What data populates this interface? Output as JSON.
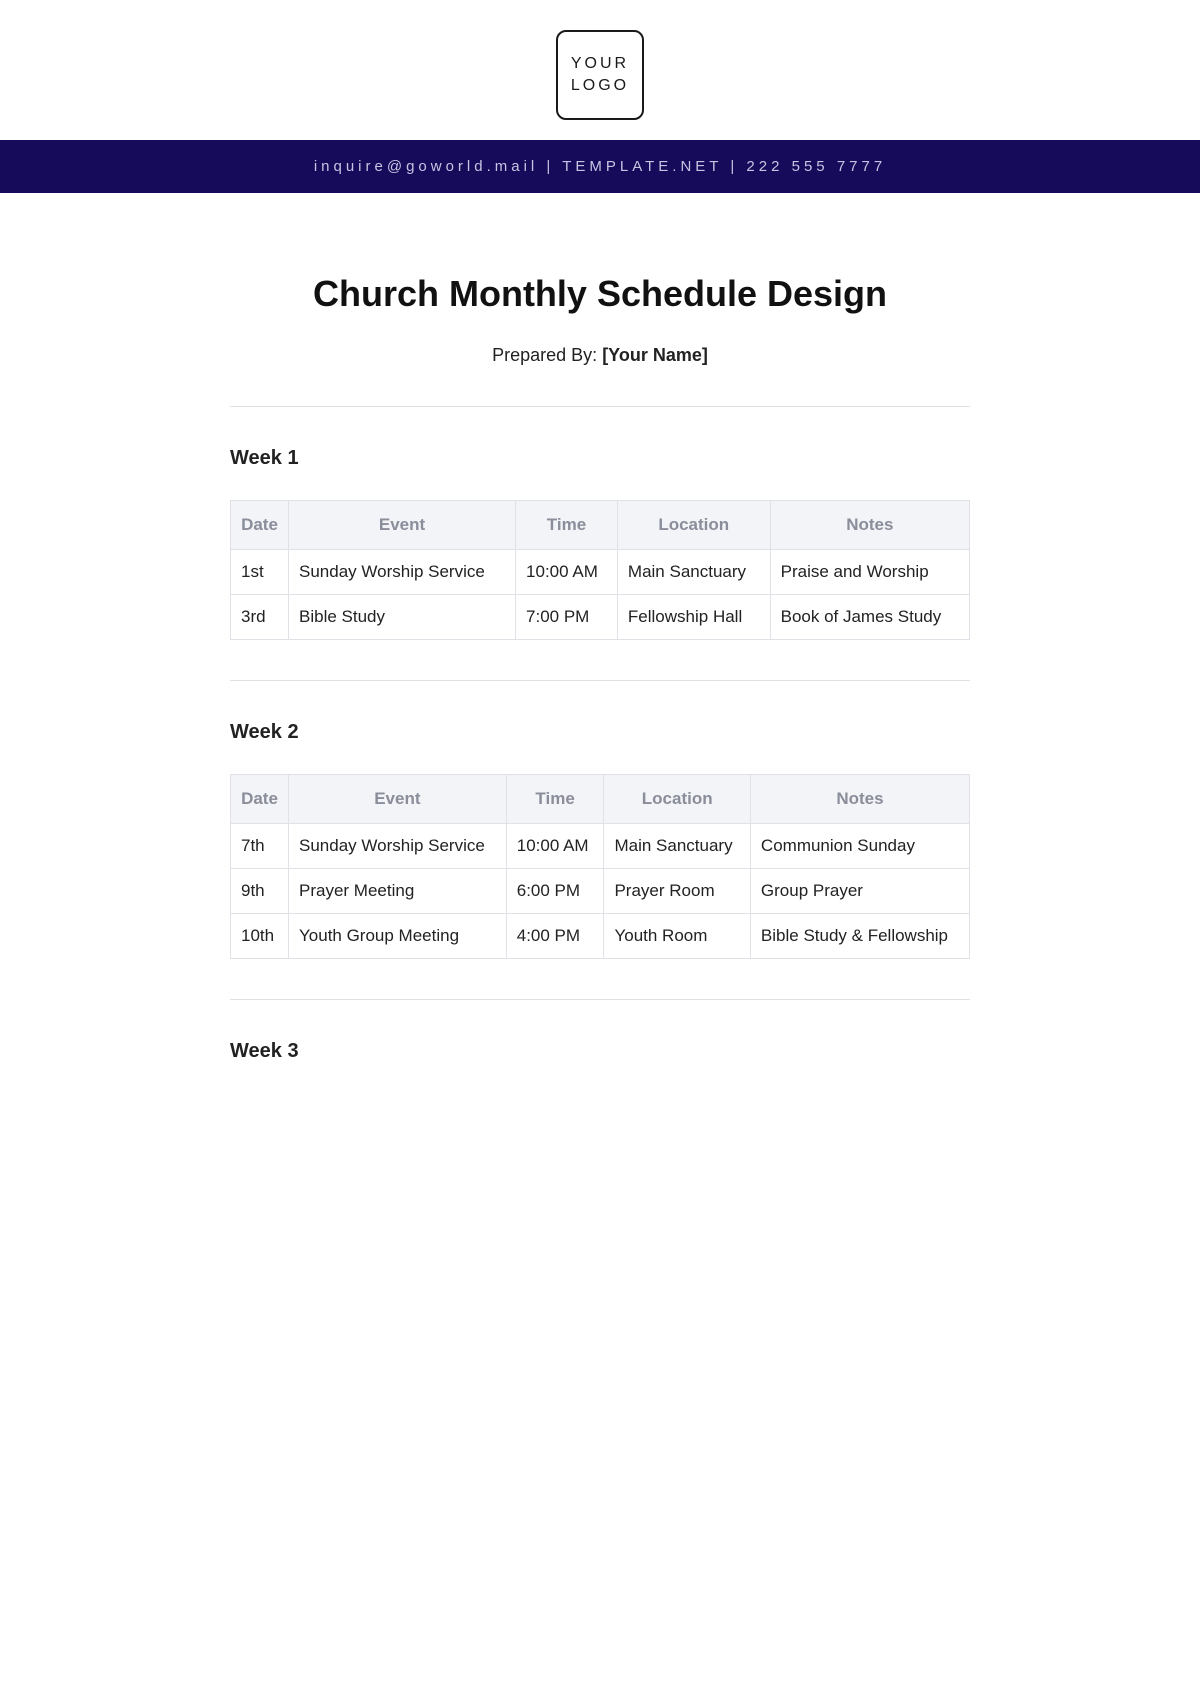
{
  "logo": {
    "line1": "YOUR",
    "line2": "LOGO"
  },
  "contact_bar": "inquire@goworld.mail | TEMPLATE.NET | 222 555 7777",
  "title": "Church Monthly Schedule Design",
  "prepared_label": "Prepared By: ",
  "prepared_name": "[Your Name]",
  "table_headers": {
    "date": "Date",
    "event": "Event",
    "time": "Time",
    "location": "Location",
    "notes": "Notes"
  },
  "weeks": [
    {
      "title": "Week 1",
      "rows": [
        {
          "date": "1st",
          "event": "Sunday Worship Service",
          "time": "10:00 AM",
          "location": "Main Sanctuary",
          "notes": "Praise and Worship"
        },
        {
          "date": "3rd",
          "event": "Bible Study",
          "time": "7:00 PM",
          "location": "Fellowship Hall",
          "notes": "Book of James Study"
        }
      ]
    },
    {
      "title": "Week 2",
      "rows": [
        {
          "date": "7th",
          "event": "Sunday Worship Service",
          "time": "10:00 AM",
          "location": "Main Sanctuary",
          "notes": "Communion Sunday"
        },
        {
          "date": "9th",
          "event": "Prayer Meeting",
          "time": "6:00 PM",
          "location": "Prayer Room",
          "notes": "Group Prayer"
        },
        {
          "date": "10th",
          "event": "Youth Group Meeting",
          "time": "4:00 PM",
          "location": "Youth Room",
          "notes": "Bible Study & Fellowship"
        }
      ]
    },
    {
      "title": "Week 3",
      "rows": []
    }
  ]
}
